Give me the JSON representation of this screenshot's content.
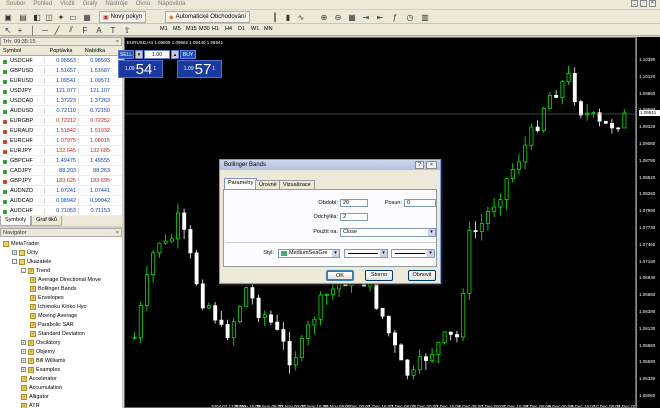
{
  "menu": [
    "Soubor",
    "Pohled",
    "Vložit",
    "Grafy",
    "Nástroje",
    "Okno",
    "Nápověda"
  ],
  "toolbar": {
    "new_order": "Nový pokyn",
    "auto_trading": "Automatické Obchodování"
  },
  "timeframes": [
    "M1",
    "M5",
    "M15",
    "M30",
    "H1",
    "H4",
    "D1",
    "W1",
    "MN"
  ],
  "market_watch": {
    "title": "Trh: 09:35:15",
    "columns": [
      "Symbol",
      "Poptávka",
      "Nabídka"
    ],
    "rows": [
      {
        "symbol": "USDCHF",
        "bid": "0.98563",
        "ask": "0.98593",
        "dir": "up"
      },
      {
        "symbol": "GBPUSD",
        "bid": "1.51657",
        "ask": "1.51687",
        "dir": "up"
      },
      {
        "symbol": "EURUSD",
        "bid": "1.09541",
        "ask": "1.09571",
        "dir": "up"
      },
      {
        "symbol": "USDJPY",
        "bid": "121.077",
        "ask": "121.107",
        "dir": "up"
      },
      {
        "symbol": "USDCAD",
        "bid": "1.37223",
        "ask": "1.37263",
        "dir": "up"
      },
      {
        "symbol": "AUDUSD",
        "bid": "0.72110",
        "ask": "0.72150",
        "dir": "up"
      },
      {
        "symbol": "EURGBP",
        "bid": "0.72212",
        "ask": "0.72252",
        "dir": "dn"
      },
      {
        "symbol": "EURAUD",
        "bid": "1.51842",
        "ask": "1.51932",
        "dir": "dn"
      },
      {
        "symbol": "EURCHF",
        "bid": "1.07975",
        "ask": "1.08015",
        "dir": "dn"
      },
      {
        "symbol": "EURJPY",
        "bid": "132.645",
        "ask": "132.685",
        "dir": "dn"
      },
      {
        "symbol": "GBPCHF",
        "bid": "1.49475",
        "ask": "1.49555",
        "dir": "up"
      },
      {
        "symbol": "CADJPY",
        "bid": "88.203",
        "ask": "88.263",
        "dir": "up"
      },
      {
        "symbol": "GBPJPY",
        "bid": "183.625",
        "ask": "183.695",
        "dir": "dn"
      },
      {
        "symbol": "AUDNZD",
        "bid": "1.07241",
        "ask": "1.07441",
        "dir": "up"
      },
      {
        "symbol": "AUDCAD",
        "bid": "0.98942",
        "ask": "0.99042",
        "dir": "up"
      },
      {
        "symbol": "AUDCHF",
        "bid": "0.71053",
        "ask": "0.71153",
        "dir": "up"
      }
    ],
    "tabs": [
      "Symboly",
      "Graf tiků"
    ]
  },
  "navigator": {
    "title": "Navigátor",
    "items": [
      {
        "label": "MetaTrader",
        "level": 0,
        "exp": ""
      },
      {
        "label": "Účty",
        "level": 1,
        "exp": "+"
      },
      {
        "label": "Ukazatele",
        "level": 1,
        "exp": "-"
      },
      {
        "label": "Trend",
        "level": 2,
        "exp": "-"
      },
      {
        "label": "Average Directional Move",
        "level": 3,
        "exp": ""
      },
      {
        "label": "Bollinger Bands",
        "level": 3,
        "exp": ""
      },
      {
        "label": "Envelopes",
        "level": 3,
        "exp": ""
      },
      {
        "label": "Ichimoku Kinko Hyo",
        "level": 3,
        "exp": ""
      },
      {
        "label": "Moving Average",
        "level": 3,
        "exp": ""
      },
      {
        "label": "Parabolic SAR",
        "level": 3,
        "exp": ""
      },
      {
        "label": "Standard Deviation",
        "level": 3,
        "exp": ""
      },
      {
        "label": "Oscilátory",
        "level": 2,
        "exp": "+"
      },
      {
        "label": "Objemy",
        "level": 2,
        "exp": "+"
      },
      {
        "label": "Bill Williams",
        "level": 2,
        "exp": "+"
      },
      {
        "label": "Examples",
        "level": 2,
        "exp": "+"
      },
      {
        "label": "Accelerator",
        "level": 2,
        "exp": ""
      },
      {
        "label": "Accumulation",
        "level": 2,
        "exp": ""
      },
      {
        "label": "Alligator",
        "level": 2,
        "exp": ""
      },
      {
        "label": "ATR",
        "level": 2,
        "exp": ""
      }
    ]
  },
  "chart": {
    "title": "EURUSD,H4  1.09608 1.09662 1.09440 1.09541",
    "sell_label": "SELL",
    "buy_label": "BUY",
    "lot": "1.00",
    "sell_price_prefix": "1.09",
    "sell_price_big": "54",
    "sell_price_sup": "1",
    "buy_price_prefix": "1.09",
    "buy_price_big": "57",
    "buy_price_sup": "1",
    "current_price": "1.09541",
    "price_ticks": [
      "1.10390",
      "1.10120",
      "1.09860",
      "1.09590",
      "1.09320",
      "1.09060",
      "1.08790",
      "1.08520",
      "1.08260",
      "1.07990",
      "1.07730",
      "1.07460",
      "1.07190",
      "1.06930",
      "1.06660",
      "1.06390",
      "1.06130",
      "1.05860",
      "1.05590",
      "1.05330",
      "1.05060"
    ],
    "time_ticks": [
      "2004.07.12 20:00",
      "25 Nov 16:00",
      "26 Nov 08:00",
      "27 Nov 00:00",
      "27 Nov 16:00",
      "30 Nov 08:00",
      "1 Dec 00:00",
      "1 Dec 16:00",
      "2 Dec 08:00",
      "3 Dec 00:00",
      "3 Dec 16:00",
      "4 Dec 08:00",
      "7 Dec 00:00",
      "7 Dec 16:00",
      "8 Dec 08:00",
      "9 Dec 00:00",
      "9 Dec 16:00",
      "10 Dec 08:00",
      "11 Dec 00:00"
    ]
  },
  "dialog": {
    "title": "Bollinger Bands",
    "tabs": [
      "Parametry",
      "Úrovně",
      "Vizualizace"
    ],
    "period_label": "Období:",
    "period_value": "20",
    "shift_label": "Posun:",
    "shift_value": "0",
    "deviation_label": "Odchylka:",
    "deviation_value": "2",
    "apply_label": "Použít na:",
    "apply_value": "Close",
    "style_label": "Styl:",
    "style_color": "MediumSeaGre",
    "ok": "OK",
    "cancel": "Storno",
    "reset": "Obnovit"
  },
  "colors": {
    "bull": "#00ff00",
    "bear": "#ffffff",
    "dialog_bg": "#ece9d8",
    "accent": "#2050c0"
  }
}
